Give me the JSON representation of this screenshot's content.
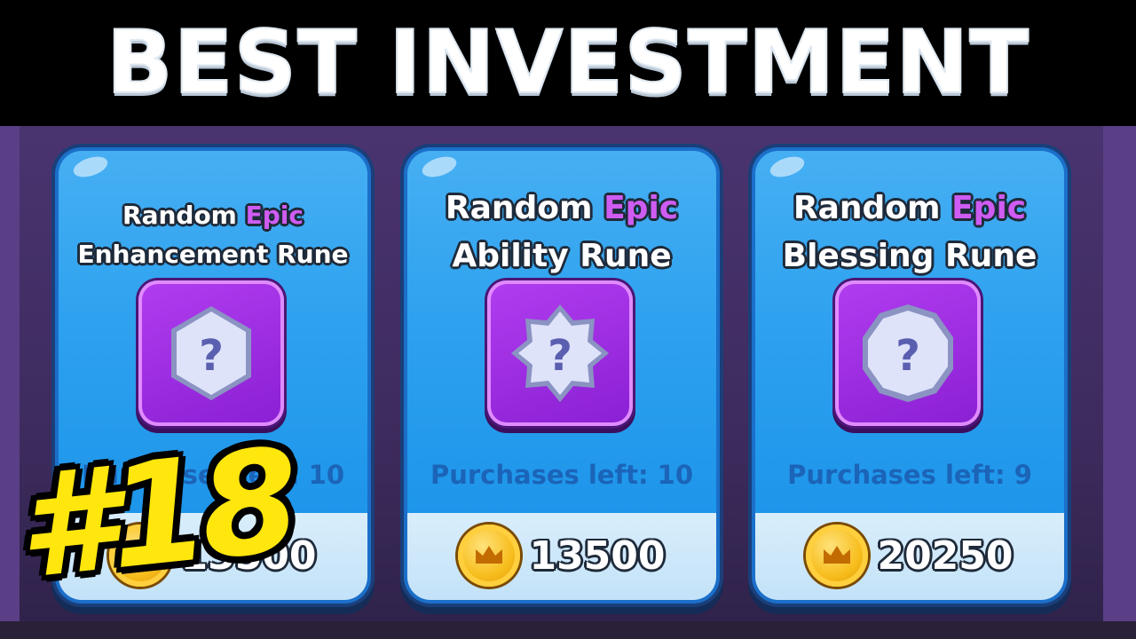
{
  "header": {
    "title": "BEST INVESTMENT"
  },
  "badge": {
    "text": "#18",
    "color": "#ffe60d"
  },
  "currency_icon": "crown-coin-icon",
  "accent": {
    "epic": "#cf5cf2",
    "card": "#2fa2ef",
    "rune_frame": "#9b2fe0",
    "purchases_text": "#1b64b8"
  },
  "cards": [
    {
      "title_prefix": "Random",
      "rarity": "Epic",
      "title_line2": "Enhancement Rune",
      "rune_icon": "hexagon-question-rune-icon",
      "purchases_label": "Purchases left: 10",
      "price": "13500"
    },
    {
      "title_prefix": "Random",
      "rarity": "Epic",
      "title_line2": "Ability Rune",
      "rune_icon": "star-question-rune-icon",
      "purchases_label": "Purchases left: 10",
      "price": "13500"
    },
    {
      "title_prefix": "Random",
      "rarity": "Epic",
      "title_line2": "Blessing Rune",
      "rune_icon": "decagon-question-rune-icon",
      "purchases_label": "Purchases left: 9",
      "price": "20250"
    }
  ]
}
